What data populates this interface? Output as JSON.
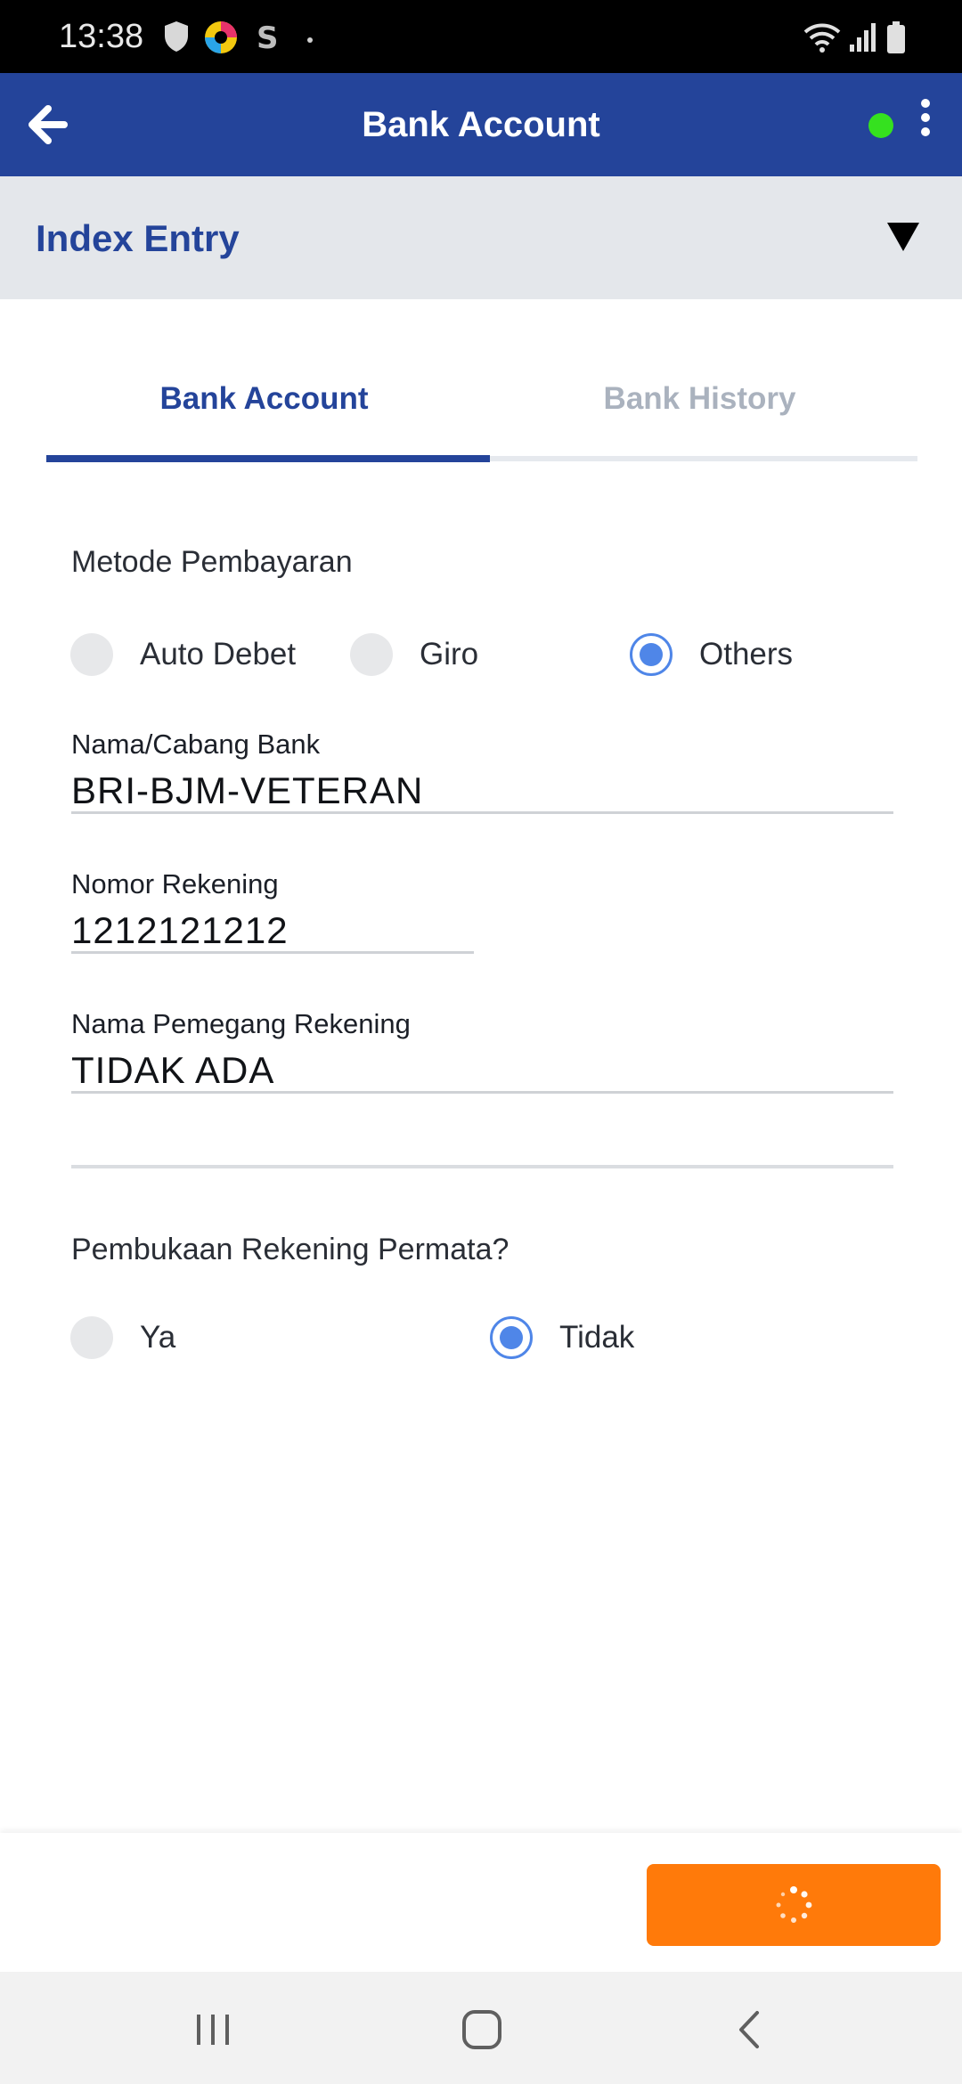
{
  "status_bar": {
    "time": "13:38",
    "icons": [
      "shield-icon",
      "app-color-icon",
      "s-app-icon",
      "dot-icon",
      "wifi-icon",
      "signal-icon",
      "battery-icon"
    ]
  },
  "app_bar": {
    "title": "Bank Account",
    "status_color": "#35e11f",
    "background": "#24449a"
  },
  "index_entry": {
    "label": "Index Entry"
  },
  "tabs": [
    {
      "label": "Bank Account",
      "active": true
    },
    {
      "label": "Bank History",
      "active": false
    }
  ],
  "payment_method": {
    "label": "Metode Pembayaran",
    "options": [
      {
        "label": "Auto Debet",
        "checked": false
      },
      {
        "label": "Giro",
        "checked": false
      },
      {
        "label": "Others",
        "checked": true
      }
    ]
  },
  "fields": {
    "bank_branch": {
      "label": "Nama/Cabang Bank",
      "value": "BRI-BJM-VETERAN"
    },
    "account_number": {
      "label": "Nomor Rekening",
      "value": "1212121212"
    },
    "account_holder": {
      "label": "Nama Pemegang Rekening",
      "value": "TIDAK ADA"
    }
  },
  "permata": {
    "label": "Pembukaan Rekening Permata?",
    "options": [
      {
        "label": "Ya",
        "checked": false
      },
      {
        "label": "Tidak",
        "checked": true
      }
    ]
  },
  "action": {
    "button_color": "#ff7a0a",
    "loading": true
  },
  "nav": [
    "recents-icon",
    "home-icon",
    "back-nav-icon"
  ]
}
